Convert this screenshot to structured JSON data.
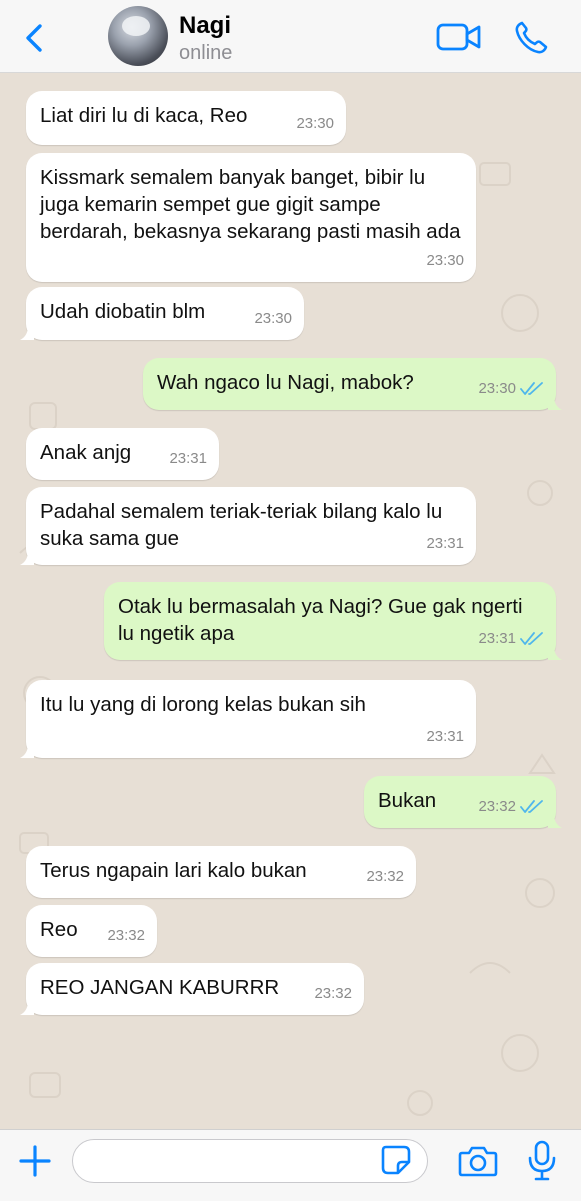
{
  "header": {
    "contact_name": "Nagi",
    "status": "online"
  },
  "messages": [
    {
      "dir": "in",
      "text": "Liat diri lu di kaca, Reo",
      "time": "23:30"
    },
    {
      "dir": "in",
      "text": "Kissmark semalem banyak banget, bibir lu juga kemarin sempet gue gigit sampe berdarah, bekasnya sekarang pasti masih ada",
      "time": "23:30"
    },
    {
      "dir": "in",
      "text": "Udah diobatin blm",
      "time": "23:30"
    },
    {
      "dir": "out",
      "text": "Wah ngaco lu Nagi, mabok?",
      "time": "23:30",
      "read": true
    },
    {
      "dir": "in",
      "text": "Anak anjg",
      "time": "23:31"
    },
    {
      "dir": "in",
      "text": "Padahal semalem teriak-teriak bilang kalo lu suka sama gue",
      "time": "23:31"
    },
    {
      "dir": "out",
      "text": "Otak lu bermasalah ya Nagi? Gue gak ngerti lu ngetik apa",
      "time": "23:31",
      "read": true
    },
    {
      "dir": "in",
      "text": "Itu lu yang di lorong kelas bukan sih",
      "time": "23:31"
    },
    {
      "dir": "out",
      "text": "Bukan",
      "time": "23:32",
      "read": true
    },
    {
      "dir": "in",
      "text": "Terus ngapain lari kalo bukan",
      "time": "23:32"
    },
    {
      "dir": "in",
      "text": "Reo",
      "time": "23:32"
    },
    {
      "dir": "in",
      "text": "REO JANGAN KABURRR",
      "time": "23:32"
    }
  ],
  "composer": {
    "input_value": "",
    "icons": [
      "plus-icon",
      "sticker-icon",
      "camera-icon",
      "microphone-icon"
    ]
  },
  "colors": {
    "accent": "#0a84ff",
    "incoming_bubble": "#ffffff",
    "outgoing_bubble": "#dcf8c6",
    "chat_background": "#e7dfd5",
    "read_ticks": "#4fb6ec"
  }
}
